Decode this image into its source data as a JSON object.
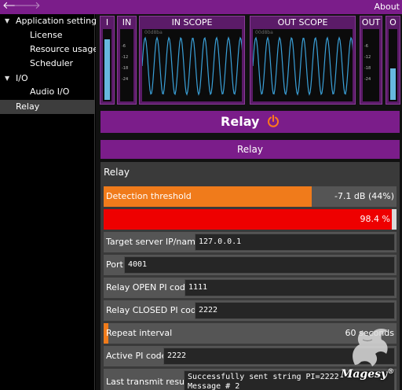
{
  "topbar": {
    "back_glyph": "🡐",
    "forward_glyph": "🡒",
    "about_label": "About"
  },
  "sidebar": {
    "items": [
      {
        "label": "Application settings",
        "expanded": true,
        "level": 0
      },
      {
        "label": "License",
        "level": 1
      },
      {
        "label": "Resource usage",
        "level": 1
      },
      {
        "label": "Scheduler",
        "level": 1
      },
      {
        "label": "I/O",
        "expanded": true,
        "level": 0
      },
      {
        "label": "Audio I/O",
        "level": 1
      },
      {
        "label": "Relay",
        "level": 0,
        "selected": true
      }
    ]
  },
  "meters": {
    "i": {
      "label": "I",
      "level_fraction": 0.88
    },
    "in": {
      "label": "IN",
      "level_fraction": 0.0,
      "ticks": [
        "-6",
        "-12",
        "-18",
        "-24"
      ]
    },
    "in_scope": {
      "label": "IN SCOPE",
      "overlay": "00d8ba"
    },
    "out_scope": {
      "label": "OUT SCOPE",
      "overlay": "00d8ba"
    },
    "out": {
      "label": "OUT",
      "level_fraction": 0.0,
      "ticks": [
        "-6",
        "-12",
        "-18",
        "-24"
      ]
    },
    "o": {
      "label": "O",
      "level_fraction": 0.45
    }
  },
  "header": {
    "title": "Relay",
    "power_icon": "power-icon",
    "power_color": "#ff7a1a"
  },
  "tab": {
    "label": "Relay"
  },
  "panel": {
    "title": "Relay",
    "detection_threshold": {
      "label": "Detection threshold",
      "value": "-7.1 dB (44%)",
      "fraction": 0.71
    },
    "level_bar": {
      "value": "98.4 %",
      "fraction": 0.984
    },
    "target_server": {
      "label": "Target server IP/name",
      "value": "127.0.0.1"
    },
    "port": {
      "label": "Port",
      "value": "4001"
    },
    "relay_open": {
      "label": "Relay OPEN PI code",
      "value": "1111"
    },
    "relay_closed": {
      "label": "Relay CLOSED PI code",
      "value": "2222"
    },
    "repeat_interval": {
      "label": "Repeat interval",
      "value": "60 seconds",
      "fraction": 0.015
    },
    "active_pi": {
      "label": "Active PI code",
      "value": "2222"
    },
    "last_transmit": {
      "label": "Last transmit result",
      "value": "Successfully sent string PI=2222\nMessage # 2"
    }
  },
  "logo": {
    "text": "Magesy",
    "mark": "®"
  },
  "colors": {
    "accent": "#7b1d8a",
    "orange": "#f07b1b",
    "red": "#ee0000",
    "meter": "#66b8df",
    "wave": "#3aa0d8"
  }
}
